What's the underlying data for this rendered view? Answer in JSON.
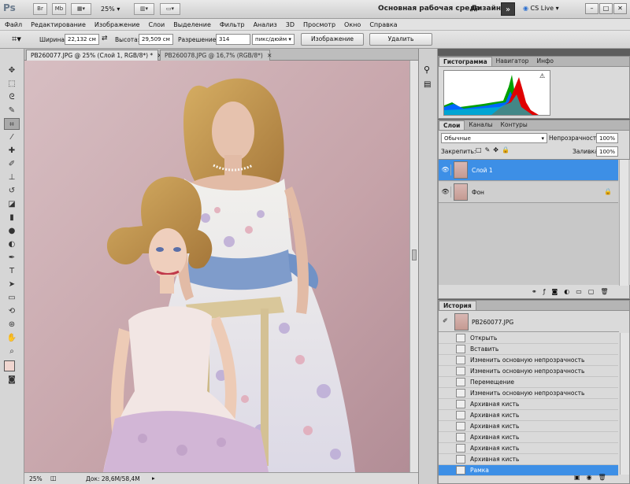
{
  "app": {
    "logo": "Ps",
    "bridge": "Br",
    "minibridge": "Mb",
    "zoom": "25%",
    "workspace_label": "Основная рабочая среда",
    "design_label": "Дизайн",
    "more_label": "»",
    "cslive_label": "CS Live",
    "window_buttons": [
      "–",
      "□",
      "✕"
    ]
  },
  "menu": [
    "Файл",
    "Редактирование",
    "Изображение",
    "Слои",
    "Выделение",
    "Фильтр",
    "Анализ",
    "3D",
    "Просмотр",
    "Окно",
    "Справка"
  ],
  "options": {
    "width_label": "Ширина:",
    "width_value": "22,132 см",
    "height_label": "Высота:",
    "height_value": "29,509 см",
    "resolution_label": "Разрешение:",
    "resolution_value": "314",
    "unit_value": "пикс/дюйм",
    "image_button": "Изображение",
    "delete_button": "Удалить"
  },
  "documents": [
    {
      "title": "PB260077.JPG @ 25% (Слой 1, RGB/8*) *",
      "active": true
    },
    {
      "title": "PB260078.JPG @ 16,7% (RGB/8*)",
      "active": false
    }
  ],
  "status": {
    "zoom": "25%",
    "doc": "Док: 28,6M/58,4M"
  },
  "histogram_panel": {
    "tabs": [
      "Гистограмма",
      "Навигатор",
      "Инфо"
    ],
    "warning": "⚠"
  },
  "layers_panel": {
    "tabs": [
      "Слои",
      "Каналы",
      "Контуры"
    ],
    "blend_mode": "Обычные",
    "opacity_label": "Непрозрачность:",
    "opacity_value": "100%",
    "lock_label": "Закрепить:",
    "fill_label": "Заливка:",
    "fill_value": "100%",
    "layers": [
      {
        "name": "Слой 1",
        "selected": true
      },
      {
        "name": "Фон",
        "selected": false
      }
    ]
  },
  "history_panel": {
    "tabs": [
      "История"
    ],
    "snapshot": "PB260077.JPG",
    "items": [
      {
        "label": "Открыть"
      },
      {
        "label": "Вставить"
      },
      {
        "label": "Изменить основную непрозрачность"
      },
      {
        "label": "Изменить основную непрозрачность"
      },
      {
        "label": "Перемещение"
      },
      {
        "label": "Изменить основную непрозрачность"
      },
      {
        "label": "Архивная кисть"
      },
      {
        "label": "Архивная кисть"
      },
      {
        "label": "Архивная кисть"
      },
      {
        "label": "Архивная кисть"
      },
      {
        "label": "Архивная кисть"
      },
      {
        "label": "Архивная кисть"
      },
      {
        "label": "Рамка",
        "selected": true
      }
    ]
  },
  "colors": {
    "accent": "#3d8fe6",
    "canvas_wall": "#c9a9ae",
    "fg_color": "#f0d6d0"
  }
}
